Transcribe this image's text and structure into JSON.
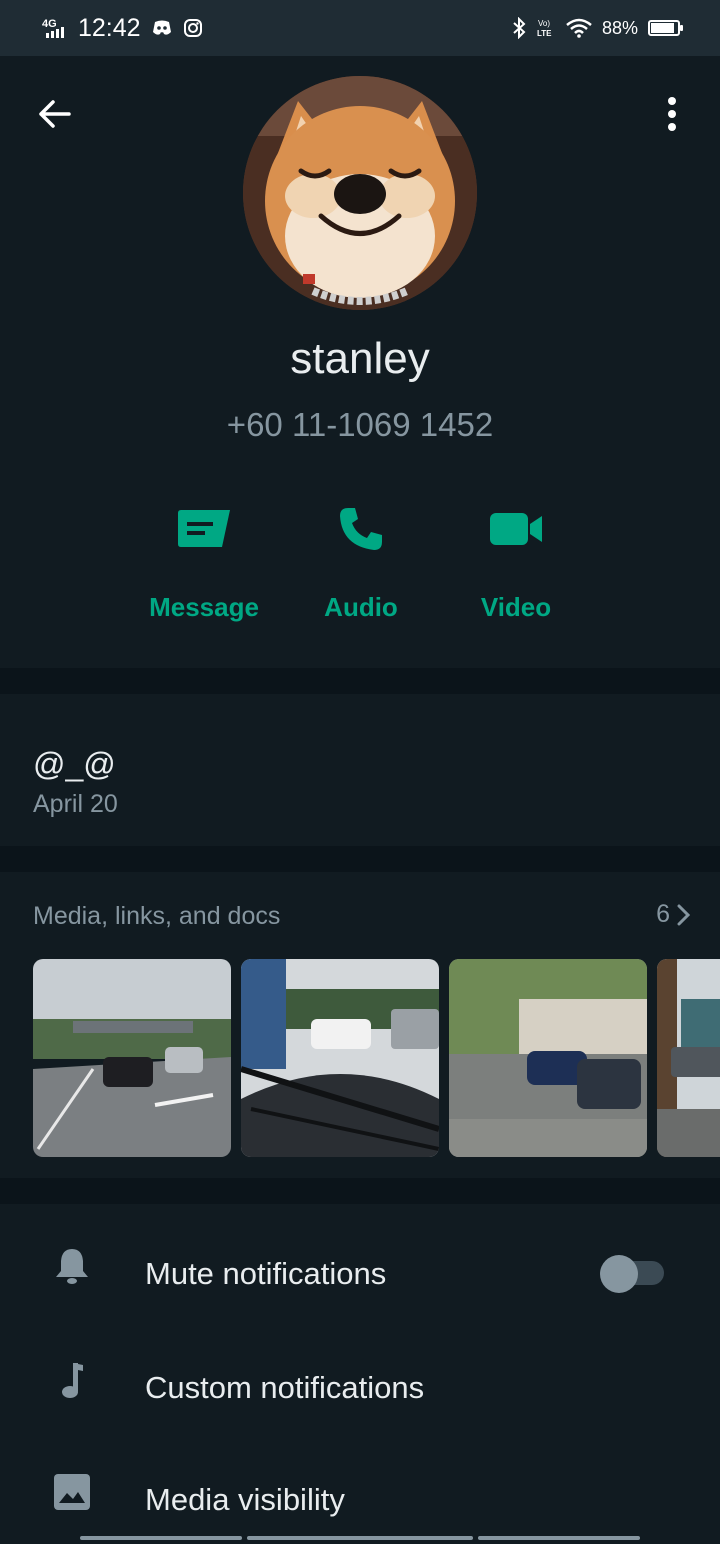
{
  "status_bar": {
    "network": "4G",
    "time": "12:42",
    "volte": "VoLTE",
    "battery_percent": "88%",
    "battery_level": 0.88
  },
  "profile": {
    "name": "stanley",
    "phone": "+60 11-1069 1452"
  },
  "actions": [
    {
      "label": "Message",
      "icon": "message-icon"
    },
    {
      "label": "Audio",
      "icon": "phone-icon"
    },
    {
      "label": "Video",
      "icon": "video-camera-icon"
    }
  ],
  "about": {
    "text": "@_@",
    "date": "April 20"
  },
  "media": {
    "title": "Media, links, and docs",
    "count": "6"
  },
  "settings": [
    {
      "label": "Mute notifications",
      "icon": "bell-icon",
      "toggle": false
    },
    {
      "label": "Custom notifications",
      "icon": "music-note-icon"
    },
    {
      "label": "Media visibility",
      "icon": "image-icon"
    }
  ],
  "colors": {
    "accent": "#00a884",
    "background": "#111b21",
    "divider": "#0b141a",
    "secondary_text": "#8696a0"
  }
}
